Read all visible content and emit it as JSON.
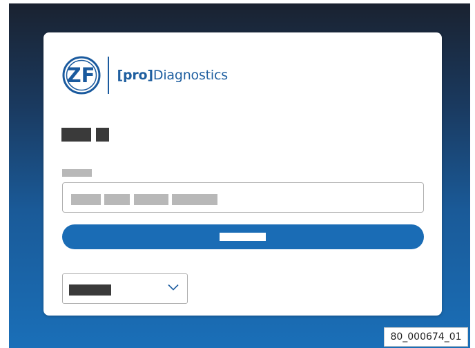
{
  "logo": {
    "mark_text": "ZF",
    "brand_bracket_open": "[",
    "brand_pro": "pro",
    "brand_bracket_close": "]",
    "brand_name": "Diagnostics"
  },
  "colors": {
    "brand_blue": "#1a5a9e",
    "button_blue": "#1a6cb5",
    "redaction_dark": "#3a3a3a",
    "redaction_light": "#b8b8b8"
  },
  "icons": {
    "select_chevron": "chevron-down-icon"
  },
  "image_id": "80_000674_01"
}
